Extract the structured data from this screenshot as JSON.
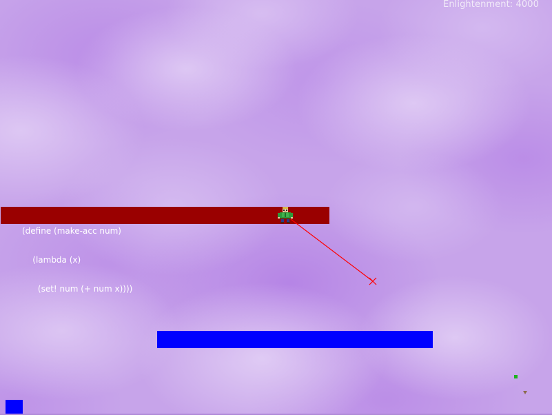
{
  "hud": {
    "score_label": "Enlightenment:",
    "score_value": "4000"
  },
  "code_lines": [
    "(define (make-acc num)",
    "    (lambda (x)",
    "      (set! num (+ num x))))"
  ],
  "colors": {
    "sky": "#c7a4ea",
    "red_platform": "#9a0000",
    "blue_platform": "#0000ff",
    "aim_line": "#ff0000",
    "hud_text": "#f1eaf8",
    "code_text": "#ffffff",
    "pickup": "#1db31d"
  },
  "icons": {
    "player": "player-character-icon",
    "crosshair": "aim-crosshair-icon",
    "pickup": "green-pickup-icon",
    "marker": "triangle-marker-icon"
  }
}
